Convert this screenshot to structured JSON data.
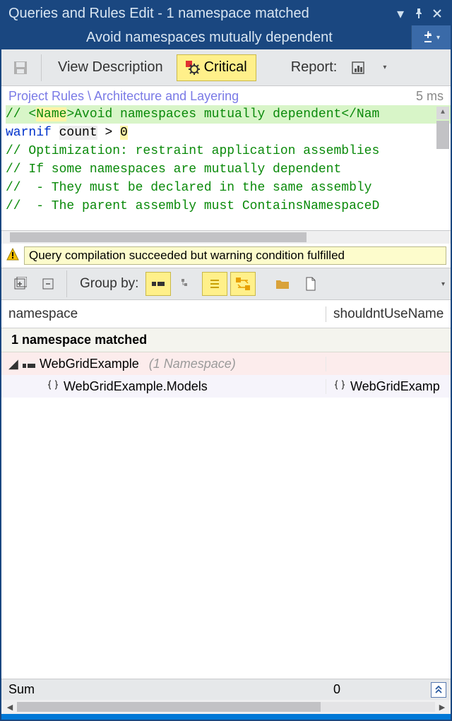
{
  "window": {
    "title": "Queries and Rules Edit  - 1 namespace matched",
    "subtitle": "Avoid namespaces mutually dependent"
  },
  "toolbar": {
    "view_description": "View Description",
    "critical": "Critical",
    "report": "Report:"
  },
  "breadcrumb": {
    "path": "Project Rules \\ Architecture and Layering",
    "timing": "5 ms"
  },
  "code": {
    "line1_prefix": "// <",
    "line1_name_tag": "Name",
    "line1_gt": ">",
    "line1_text": "Avoid namespaces mutually dependent",
    "line1_suffix": "</Nam",
    "line2_warnif": "warnif",
    "line2_count": "count",
    "line2_gt": " > ",
    "line2_zero": "0",
    "line3": "",
    "line4": "// Optimization: restraint application assemblies",
    "line5": "// If some namespaces are mutually dependent",
    "line6": "//  - They must be declared in the same assembly",
    "line7": "//  - The parent assembly must ContainsNamespaceD"
  },
  "status": {
    "message": "Query compilation succeeded but warning condition fulfilled"
  },
  "grouping": {
    "label": "Group by:"
  },
  "columns": {
    "col1": "namespace",
    "col2": "shouldntUseName"
  },
  "group_header": "1 namespace matched",
  "rows": {
    "parent_name": "WebGridExample",
    "parent_hint": "(1 Namespace)",
    "child_name": "WebGridExample.Models",
    "child_col2": "WebGridExamp"
  },
  "summary": {
    "label": "Sum",
    "value": "0"
  }
}
